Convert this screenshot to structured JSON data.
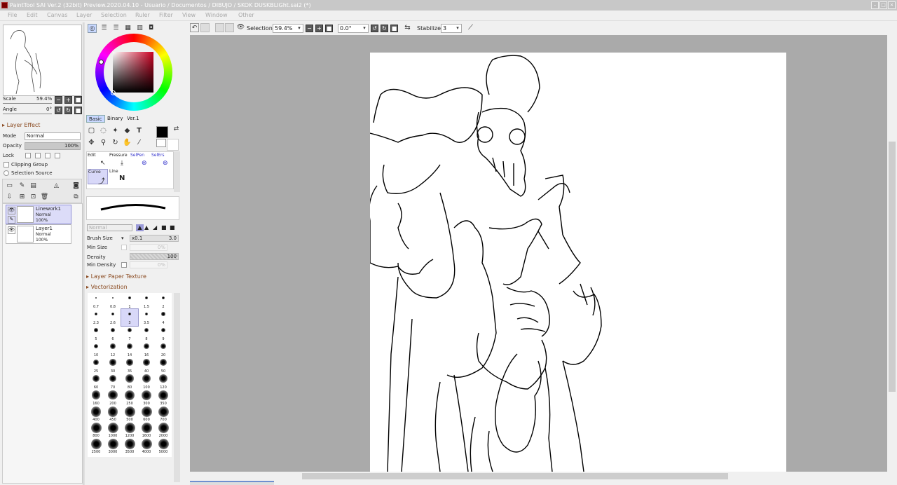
{
  "window": {
    "title": "PaintTool SAI Ver.2 (32bit) Preview.2020.04.10 - Usuario / Documentos / DIBUJO / SKOK DUSKBLIGht.sai2 (*)",
    "minimize": "–",
    "maximize": "□",
    "close": "×"
  },
  "menu": [
    "File",
    "Edit",
    "Canvas",
    "Layer",
    "Selection",
    "Ruler",
    "Filter",
    "View",
    "Window",
    "Other"
  ],
  "navigator": {
    "scale_label": "Scale",
    "scale_value": "59.4%",
    "angle_label": "Angle",
    "angle_value": "0°"
  },
  "layer_panel": {
    "section_title": "Layer Effect",
    "mode_label": "Mode",
    "mode_value": "Normal",
    "opacity_label": "Opacity",
    "opacity_value": "100%",
    "lock_label": "Lock",
    "clipping_group": "Clipping Group",
    "selection_source": "Selection Source",
    "layers": [
      {
        "name": "Linework1",
        "mode": "Normal",
        "opacity": "100%"
      },
      {
        "name": "Layer1",
        "mode": "Normal",
        "opacity": "100%"
      }
    ]
  },
  "tool_tabs": [
    "Basic",
    "Binary",
    "Ver.1"
  ],
  "tool_modes": [
    {
      "label": "Edit"
    },
    {
      "label": "Pressure"
    },
    {
      "label": "SelPen"
    },
    {
      "label": "SelErs"
    },
    {
      "label": "Curve"
    },
    {
      "label": "Line"
    }
  ],
  "brush": {
    "blend_mode": "Normal",
    "size_label": "Brush Size",
    "size_mult": "x0.1",
    "size_value": "3.0",
    "min_size_label": "Min Size",
    "min_size_value": "0%",
    "density_label": "Density",
    "density_value": "100",
    "min_density_label": "Min Density",
    "min_density_value": "0%",
    "paper_texture": "Layer Paper Texture",
    "vectorization": "Vectorization",
    "sizes": [
      "0.7",
      "0.8",
      "1",
      "1.5",
      "2",
      "2.3",
      "2.6",
      "3",
      "3.5",
      "4",
      "5",
      "6",
      "7",
      "8",
      "9",
      "10",
      "12",
      "14",
      "16",
      "20",
      "25",
      "30",
      "35",
      "40",
      "50",
      "60",
      "70",
      "80",
      "100",
      "120",
      "160",
      "200",
      "250",
      "300",
      "350",
      "400",
      "450",
      "500",
      "600",
      "700",
      "800",
      "1000",
      "1200",
      "1600",
      "2000",
      "2500",
      "3000",
      "3500",
      "4000",
      "5000"
    ],
    "selected_size": "3"
  },
  "toolbar": {
    "selection_label": "Selection",
    "zoom": "59.4%",
    "rotation": "0.0°",
    "stabilizer_label": "Stabilizer",
    "stabilizer_value": "3"
  },
  "colors": {
    "primary": "#000000",
    "secondary": "#ffffff",
    "accent": "#9090d8",
    "wheel_hue": "#cc0022"
  }
}
